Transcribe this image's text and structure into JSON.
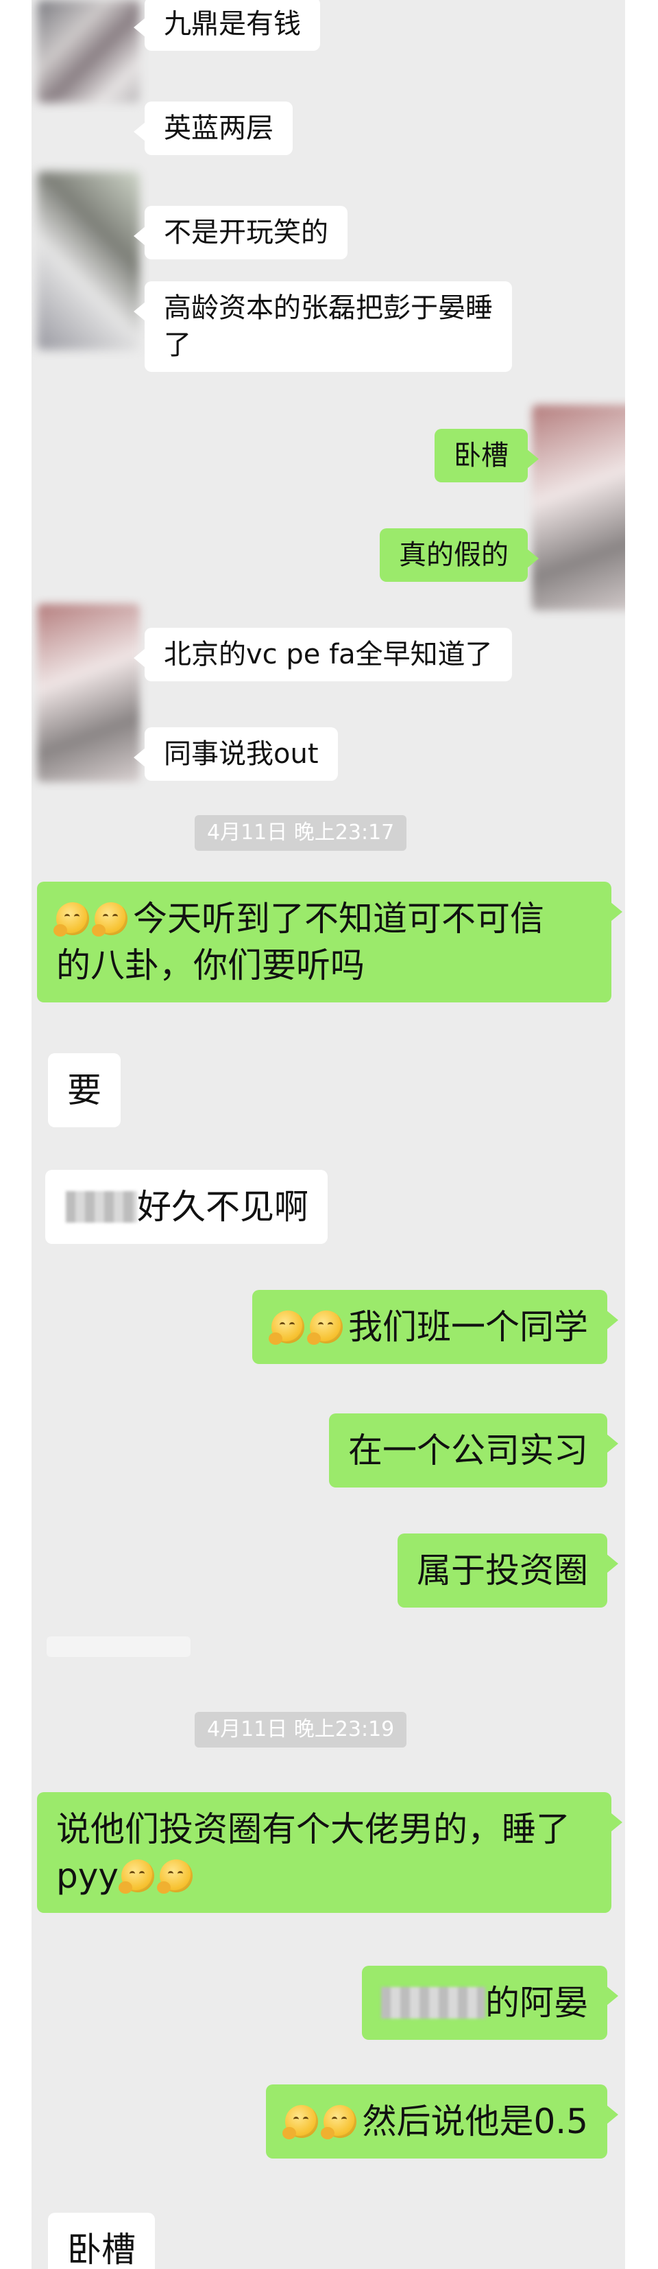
{
  "panel1": {
    "messages": [
      {
        "side": "left",
        "text": "九鼎是有钱"
      },
      {
        "side": "left",
        "text": "英蓝两层"
      },
      {
        "side": "left",
        "text": "不是开玩笑的"
      },
      {
        "side": "left",
        "text": "高龄资本的张磊把彭于晏睡",
        "text2": "了"
      },
      {
        "side": "right",
        "text": "卧槽"
      },
      {
        "side": "right",
        "text": "真的假的"
      },
      {
        "side": "left",
        "text": "北京的vc pe fa全早知道了"
      },
      {
        "side": "left",
        "text": "同事说我out"
      }
    ]
  },
  "panel2": {
    "timestamp1": "4月11日 晚上23:17",
    "timestamp2": "4月11日 晚上23:19",
    "messages": [
      {
        "side": "right",
        "text": "今天听到了不知道可不可信",
        "text2": "的八卦，你们要听吗",
        "emoji": "thinking-face"
      },
      {
        "side": "left",
        "text": "要"
      },
      {
        "side": "left",
        "text": "好久不见啊"
      },
      {
        "side": "right",
        "text": "我们班一个同学",
        "emoji": "thinking-face"
      },
      {
        "side": "right",
        "text": "在一个公司实习"
      },
      {
        "side": "right",
        "text": "属于投资圈"
      },
      {
        "side": "right",
        "text": "说他们投资圈有个大佬男的，睡了",
        "text2": "pyy"
      },
      {
        "side": "right",
        "text": "的阿晏"
      },
      {
        "side": "right",
        "text": "然后说他是0.5"
      },
      {
        "side": "left",
        "text": "卧槽"
      }
    ]
  },
  "colors": {
    "outgoing": "#9bea6b",
    "incoming": "#ffffff",
    "background": "#ececec",
    "timestamp": "#d2d2d2"
  }
}
